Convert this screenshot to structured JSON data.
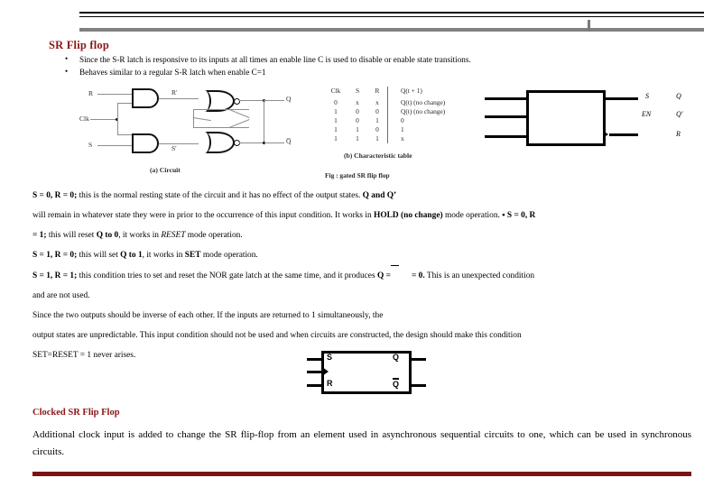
{
  "slide": {
    "title": "SR Flip flop",
    "accent_color": "#8c1717",
    "bottom_bar_color": "#7d1113",
    "bullets": [
      "Since the S-R latch is responsive to its inputs at all times an enable line C is used to disable or  enable state transitions.",
      "Behaves similar to a regular S-R latch when enable C=1"
    ],
    "figure_caption": "Fig : gated SR flip flop",
    "circuit": {
      "caption": "(a) Circuit",
      "input_labels": [
        "R",
        "Clk",
        "S"
      ],
      "intermediate_labels": [
        "R′",
        "S′"
      ],
      "output_labels": [
        "Q",
        "Q̅"
      ],
      "gate_types": [
        "AND",
        "AND",
        "NOR",
        "NOR"
      ]
    },
    "characteristic_table": {
      "caption": "(b) Characteristic table",
      "headers": [
        "Clk",
        "S",
        "R",
        "Q(t + 1)"
      ],
      "rows": [
        [
          "0",
          "x",
          "x",
          "Q(t)  (no change)"
        ],
        [
          "1",
          "0",
          "0",
          "Q(t)  (no change)"
        ],
        [
          "1",
          "0",
          "1",
          "0"
        ],
        [
          "1",
          "1",
          "0",
          "1"
        ],
        [
          "1",
          "1",
          "1",
          "x"
        ]
      ]
    },
    "block_symbol": {
      "input_labels": [
        "S",
        "EN",
        "R"
      ],
      "output_labels": [
        "Q",
        "Q′"
      ]
    },
    "flipflop_symbol": {
      "input_labels": [
        "S",
        "R"
      ],
      "clock_label": "",
      "output_labels": [
        "Q",
        "Q"
      ]
    }
  },
  "body": {
    "para1_pre": "S = 0, R = 0;",
    "para1_mid": " this is the normal resting state of the circuit and it has no effect of the output states. ",
    "para1_bold2": "Q and Q’",
    "para2_pre": "will remain in whatever state they were in prior to the occurrence of this input condition. It works in ",
    "para2_bold": "HOLD (no change)",
    "para2_mid": " mode operation. ▪ ",
    "para2_bold2": "S = 0, R",
    "para3_bold": "= 1;",
    "para3_mid": " this will reset ",
    "para3_bold2": "Q to 0",
    "para3_post": ", it works in ",
    "para3_italic": "RESET",
    "para3_end": " mode  operation.",
    "para4_bold": "S = 1, R = 0;",
    "para4_mid": " this will set ",
    "para4_bold2": "Q to 1",
    "para4_post": ", it works in ",
    "para4_bold3": "SET",
    "para4_end": " mode operation.",
    "para5_bold": "S = 1, R = 1;",
    "para5_mid": " this condition tries to set and reset the NOR gate latch at the same time, and it  produces  ",
    "para5_bold2": "Q =",
    "para5_after_bar": "= 0.",
    "para5_end": " This is an unexpected condition",
    "para6": "and are not used.",
    "para7": "Since the two outputs should be inverse of each other. If the inputs are returned to 1 simultaneously, the",
    "para8": "output states are unpredictable. This input condition should not be used and when circuits are constructed,  the design should make  this condition",
    "para9": "SET=RESET = 1 never arises."
  },
  "bottom": {
    "title": "Clocked SR Flip Flop",
    "text": "Additional clock input is added to change the SR flip-flop from an element used in asynchronous  sequential circuits to one, which can be used in synchronous circuits."
  }
}
